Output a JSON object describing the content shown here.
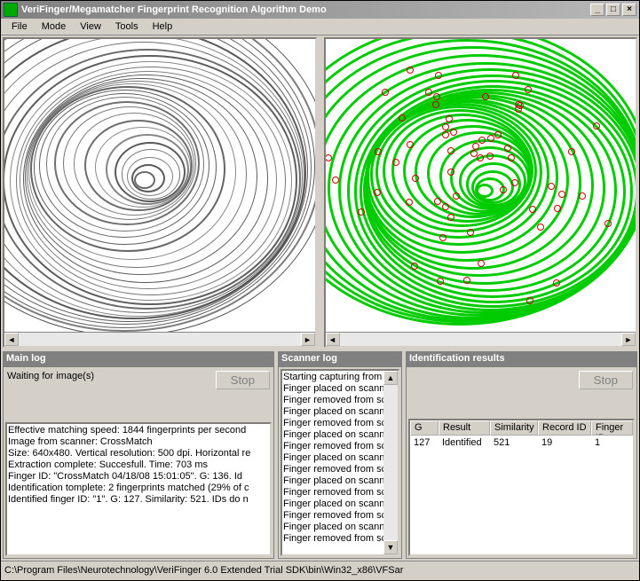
{
  "window": {
    "title": "VeriFinger/Megamatcher Fingerprint Recognition Algorithm Demo"
  },
  "menu": {
    "file": "File",
    "mode": "Mode",
    "view": "View",
    "tools": "Tools",
    "help": "Help"
  },
  "panels": {
    "main_log_title": "Main log",
    "scanner_log_title": "Scanner log",
    "id_results_title": "Identification results"
  },
  "main_log": {
    "waiting": "Waiting for image(s)",
    "stop": "Stop",
    "lines": [
      "Effective matching speed: 1844 fingerprints per second",
      "",
      "Image from scanner: CrossMatch",
      "Size: 640x480. Vertical resolution: 500 dpi. Horizontal re",
      "Extraction complete: Succesfull. Time: 703 ms",
      "Finger ID: \"CrossMatch 04/18/08 15:01:05\". G: 136. Id",
      "Identification tomplete: 2 fingerprints matched (29% of c",
      "Identified finger ID: \"1\". G: 127. Similarity: 521. IDs do n"
    ]
  },
  "scanner_log": {
    "lines": [
      "Starting capturing from sc",
      "Finger placed on scanne",
      "Finger removed from scan",
      "Finger placed on scanne",
      "Finger removed from scan",
      "Finger placed on scanne",
      "Finger removed from scan",
      "Finger placed on scanne",
      "Finger removed from scan",
      "Finger placed on scanne",
      "Finger removed from scan",
      "Finger placed on scanne",
      "Finger removed from scan",
      "Finger placed on scanne",
      "Finger removed from scan"
    ]
  },
  "id_results": {
    "stop": "Stop",
    "headers": {
      "g": "G",
      "result": "Result",
      "similarity": "Similarity",
      "record_id": "Record ID",
      "finger_id": "Finger ID"
    },
    "row": {
      "g": "127",
      "result": "Identified",
      "similarity": "521",
      "record_id": "19",
      "finger_id": "1"
    }
  },
  "statusbar": {
    "path": "C:\\Program Files\\Neurotechnology\\VeriFinger 6.0 Extended Trial SDK\\bin\\Win32_x86\\VFSar"
  }
}
